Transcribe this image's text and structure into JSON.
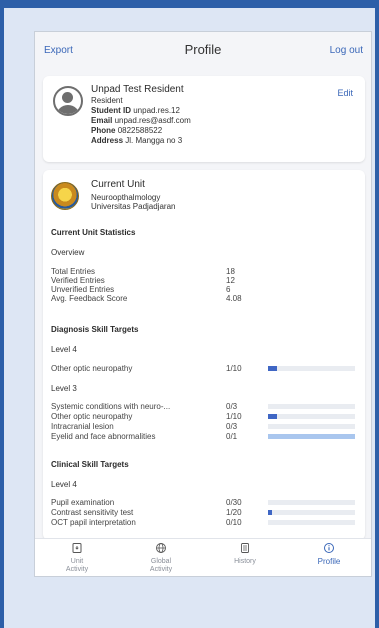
{
  "header": {
    "export": "Export",
    "title": "Profile",
    "logout": "Log out"
  },
  "profile": {
    "name": "Unpad Test Resident",
    "role": "Resident",
    "student_id_label": "Student ID",
    "student_id": "unpad.res.12",
    "email_label": "Email",
    "email": "unpad.res@asdf.com",
    "phone_label": "Phone",
    "phone": "0822588522",
    "address_label": "Address",
    "address": "Jl. Mangga no 3",
    "edit": "Edit"
  },
  "current_unit": {
    "heading": "Current Unit",
    "unit": "Neuroopthalmology",
    "university": "Universitas Padjadjaran"
  },
  "stats": {
    "heading": "Current Unit Statistics",
    "overview_label": "Overview",
    "overview": [
      {
        "label": "Total Entries",
        "value": "18"
      },
      {
        "label": "Verified Entries",
        "value": "12"
      },
      {
        "label": "Unverified Entries",
        "value": "6"
      },
      {
        "label": "Avg. Feedback Score",
        "value": "4.08"
      }
    ]
  },
  "diagnosis": {
    "heading": "Diagnosis Skill Targets",
    "level4_label": "Level 4",
    "level4": [
      {
        "label": "Other optic neuropathy",
        "value": "1/10",
        "fraction": 0.1,
        "color": "#3f66c4"
      }
    ],
    "level3_label": "Level 3",
    "level3": [
      {
        "label": "Systemic conditions with neuro-...",
        "value": "0/3",
        "fraction": 0,
        "color": "#3f66c4"
      },
      {
        "label": "Other optic neuropathy",
        "value": "1/10",
        "fraction": 0.1,
        "color": "#3f66c4"
      },
      {
        "label": "Intracranial lesion",
        "value": "0/3",
        "fraction": 0,
        "color": "#3f66c4"
      },
      {
        "label": "Eyelid and face abnormalities",
        "value": "0/1",
        "fraction": 1,
        "color": "#a9c6ee"
      }
    ]
  },
  "clinical": {
    "heading": "Clinical Skill Targets",
    "level4_label": "Level 4",
    "level4": [
      {
        "label": "Pupil examination",
        "value": "0/30",
        "fraction": 0,
        "color": "#3f66c4"
      },
      {
        "label": "Contrast sensitivity test",
        "value": "1/20",
        "fraction": 0.05,
        "color": "#3f66c4"
      },
      {
        "label": "OCT papil interpretation",
        "value": "0/10",
        "fraction": 0,
        "color": "#3f66c4"
      }
    ]
  },
  "tabs": [
    {
      "label": "Unit\nActivity",
      "icon": "unit-activity-icon"
    },
    {
      "label": "Global\nActivity",
      "icon": "globe-icon"
    },
    {
      "label": "History",
      "icon": "history-icon"
    },
    {
      "label": "Profile",
      "icon": "info-icon",
      "active": true
    }
  ],
  "colors": {
    "accent": "#3a67b8",
    "frame": "#2d5fa8"
  }
}
